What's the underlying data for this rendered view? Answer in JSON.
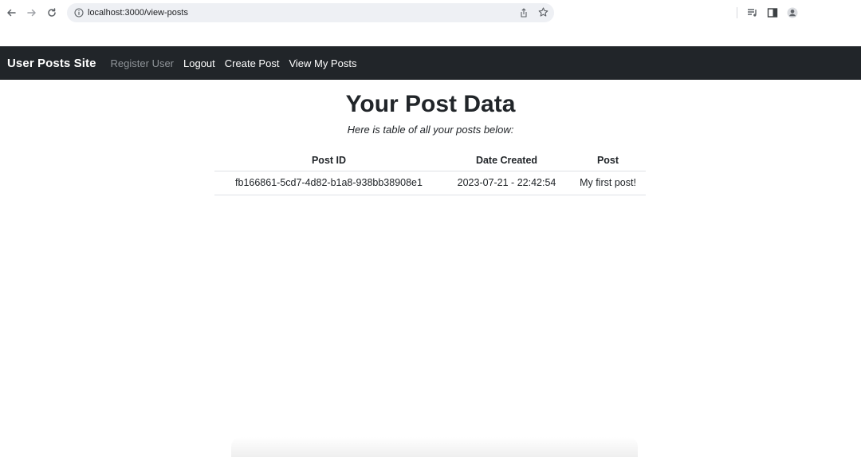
{
  "browser": {
    "url": "localhost:3000/view-posts",
    "icons": [
      "back-arrow-icon",
      "forward-arrow-icon",
      "reload-icon",
      "info-icon",
      "share-icon",
      "star-icon",
      "media-control-icon",
      "side-panel-icon",
      "profile-icon"
    ]
  },
  "navbar": {
    "brand": "User Posts Site",
    "links": [
      {
        "label": "Register User",
        "state": "disabled"
      },
      {
        "label": "Logout",
        "state": "active"
      },
      {
        "label": "Create Post",
        "state": "active"
      },
      {
        "label": "View My Posts",
        "state": "active"
      }
    ],
    "background": "#212529"
  },
  "main": {
    "title": "Your Post Data",
    "subtitle": "Here is table of all your posts below:",
    "table": {
      "headers": [
        "Post ID",
        "Date Created",
        "Post"
      ],
      "rows": [
        [
          "fb166861-5cd7-4d82-b1a8-938bb38908e1",
          "2023-07-21 - 22:42:54",
          "My first post!"
        ]
      ]
    }
  }
}
